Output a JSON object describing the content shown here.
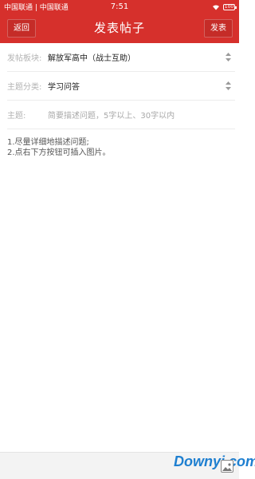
{
  "status_bar": {
    "carrier": "中国联通 | 中国联通",
    "time": "7:51",
    "battery": "100"
  },
  "nav": {
    "back_label": "返回",
    "title": "发表帖子",
    "publish_label": "发表"
  },
  "form": {
    "board": {
      "label": "发帖板块:",
      "value": "解放军高中（战士互助）"
    },
    "category": {
      "label": "主题分类:",
      "value": "学习问答"
    },
    "subject": {
      "label": "主题:",
      "placeholder": "简要描述问题，5字以上、30字以内"
    }
  },
  "content": {
    "hint_line1": "1.尽量详细地描述问题;",
    "hint_line2": "2.点右下方按钮可插入图片。"
  },
  "watermark": {
    "part1": "Downyi",
    "dot": ".",
    "part2": "com"
  },
  "colors": {
    "header": "#d6302c",
    "label": "#b3b3b3",
    "watermark_blue": "#1e7fd0",
    "watermark_orange": "#f08c1e"
  }
}
